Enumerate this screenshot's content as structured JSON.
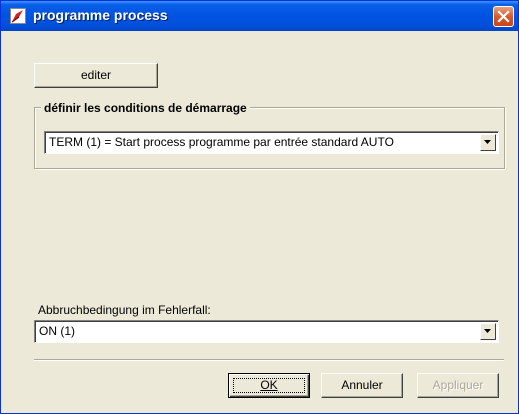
{
  "window": {
    "title": "programme process",
    "icon": "app-icon",
    "close_icon": "close-icon"
  },
  "toolbar": {
    "edit_label": "editer"
  },
  "start_conditions": {
    "group_title": "définir les conditions de démarrage",
    "selected": "TERM (1) = Start process programme par entrée standard  AUTO"
  },
  "abort_condition": {
    "label": "Abbruchbedingung im Fehlerfall:",
    "selected": "ON (1)"
  },
  "buttons": {
    "ok_label": "OK",
    "cancel_label": "Annuler",
    "apply_label": "Appliquer"
  },
  "colors": {
    "titlebar": "#0054e3",
    "close_button": "#d85a2e",
    "dialog_background": "#ece9d8"
  }
}
